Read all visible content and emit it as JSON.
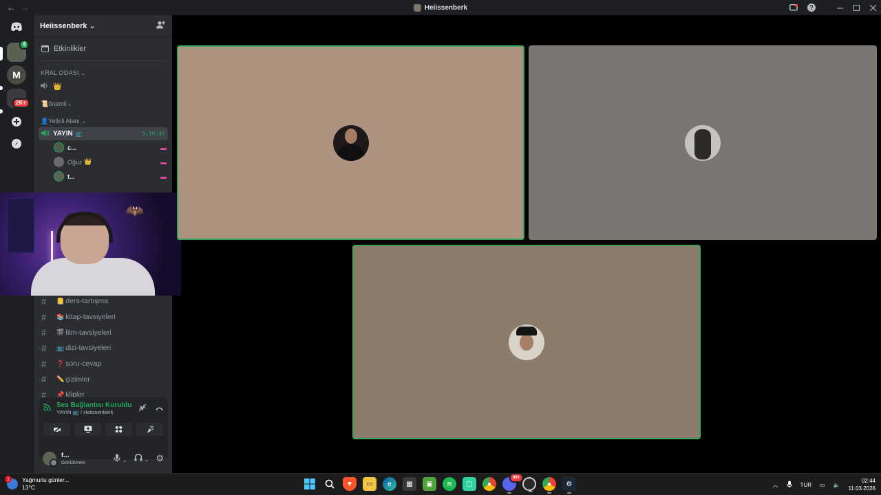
{
  "window": {
    "title": "Heiissenberk",
    "back": "←",
    "forward": "→",
    "help": "?"
  },
  "rail": {
    "discord_glyph": "◉",
    "server2_initial": "M",
    "badge_green": "4",
    "badge_unread": "2K+"
  },
  "server": {
    "name": "Heiissenberk",
    "events_label": "Etkinlikler",
    "category_kral": "KRAL ODASI",
    "crown_channel": "👑",
    "onemli": "📜önemli",
    "yetkili": "👤Yetkili Alanı",
    "voice_channel": {
      "name": "YAYIN",
      "emoji": "📺",
      "timer": "5:19:40",
      "members": [
        {
          "name": "c...",
          "suffix": ""
        },
        {
          "name": "Oğuz",
          "suffix": "👑"
        },
        {
          "name": "t...",
          "suffix": ""
        }
      ]
    },
    "text_channels": [
      {
        "emoji": "📒",
        "name": "ders-tartışma"
      },
      {
        "emoji": "📚",
        "name": "kitap-tavsiyeleri"
      },
      {
        "emoji": "🎬",
        "name": "film-tavsiyeleri"
      },
      {
        "emoji": "📺",
        "name": "dizi-tavsiyeleri"
      },
      {
        "emoji": "❓",
        "name": "soru-cevap"
      },
      {
        "emoji": "✏️",
        "name": "çizimler"
      },
      {
        "emoji": "📌",
        "name": "klipler"
      }
    ]
  },
  "voice_panel": {
    "status": "Ses Bağlantısı Kuruldu",
    "channel": "YAYIN 📺 / Heiissenberk"
  },
  "user_panel": {
    "name": "t...",
    "status": "Görünmez"
  },
  "taskbar": {
    "weather_title": "Yağmurlu günler...",
    "weather_temp": "13°C",
    "weather_badge": "1",
    "language": "TUR",
    "time": "02:44",
    "date": "11.03.2026",
    "discord_badge": "99+"
  },
  "colors": {
    "accent_green": "#23a55a",
    "speaking_border": "#3ba55d",
    "sidebar_bg": "#2b2d31",
    "rail_bg": "#1e1f22",
    "live_pink": "#eb459e"
  }
}
